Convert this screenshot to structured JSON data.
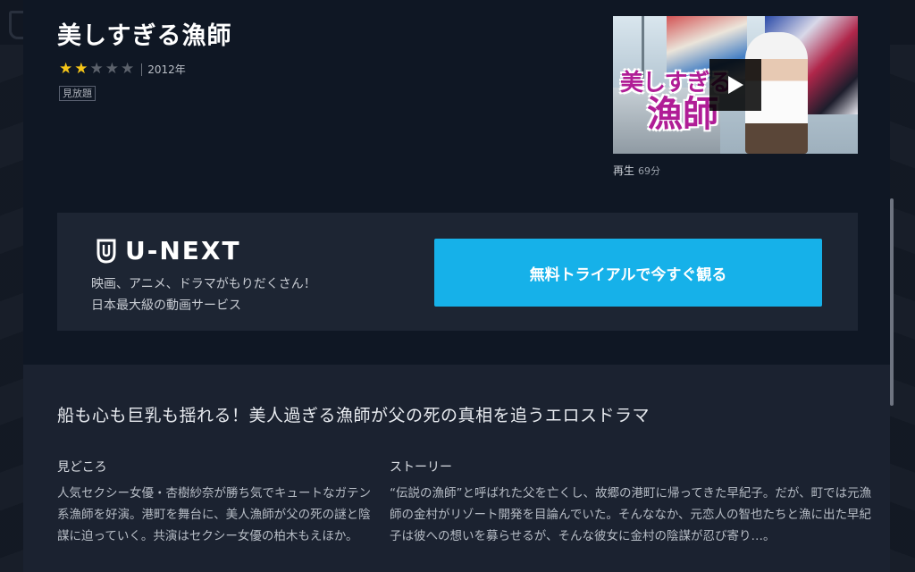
{
  "modal": {
    "close_label": "×",
    "title": "美しすぎる漁師",
    "rating": {
      "score": 2,
      "max": 5
    },
    "year": "2012年",
    "badge": "見放題",
    "thumbnail": {
      "logo_line1": "美しすぎる",
      "logo_line2": "漁師"
    },
    "duration": {
      "label": "再生",
      "value": "69分"
    }
  },
  "promo": {
    "brand": "U-NEXT",
    "line1": "映画、アニメ、ドラマがもりだくさん！",
    "line2": "日本最大級の動画サービス",
    "cta_label": "無料トライアルで今すぐ観る"
  },
  "details": {
    "tagline": "船も心も巨乳も揺れる！美人過ぎる漁師が父の死の真相を追うエロスドラマ",
    "highlights_title": "見どころ",
    "highlights_body": "人気セクシー女優・杏樹紗奈が勝ち気でキュートなガテン系漁師を好演。港町を舞台に、美人漁師が父の死の謎と陰謀に迫っていく。共演はセクシー女優の柏木もえほか。",
    "story_title": "ストーリー",
    "story_body": "“伝説の漁師”と呼ばれた父を亡くし、故郷の港町に帰ってきた早紀子。だが、町では元漁師の金村がリゾート開発を目論んでいた。そんななか、元恋人の智也たちと漁に出た早紀子は彼への想いを募らせるが、そんな彼女に金村の陰謀が忍び寄り…。"
  },
  "colors": {
    "accent": "#16b1e9",
    "star_on": "#f5c518",
    "star_off": "#5b616b",
    "thumb_logo": "#b01d96"
  },
  "icons": [
    "close-icon",
    "star-icon",
    "play-icon",
    "unext-logo-icon"
  ]
}
